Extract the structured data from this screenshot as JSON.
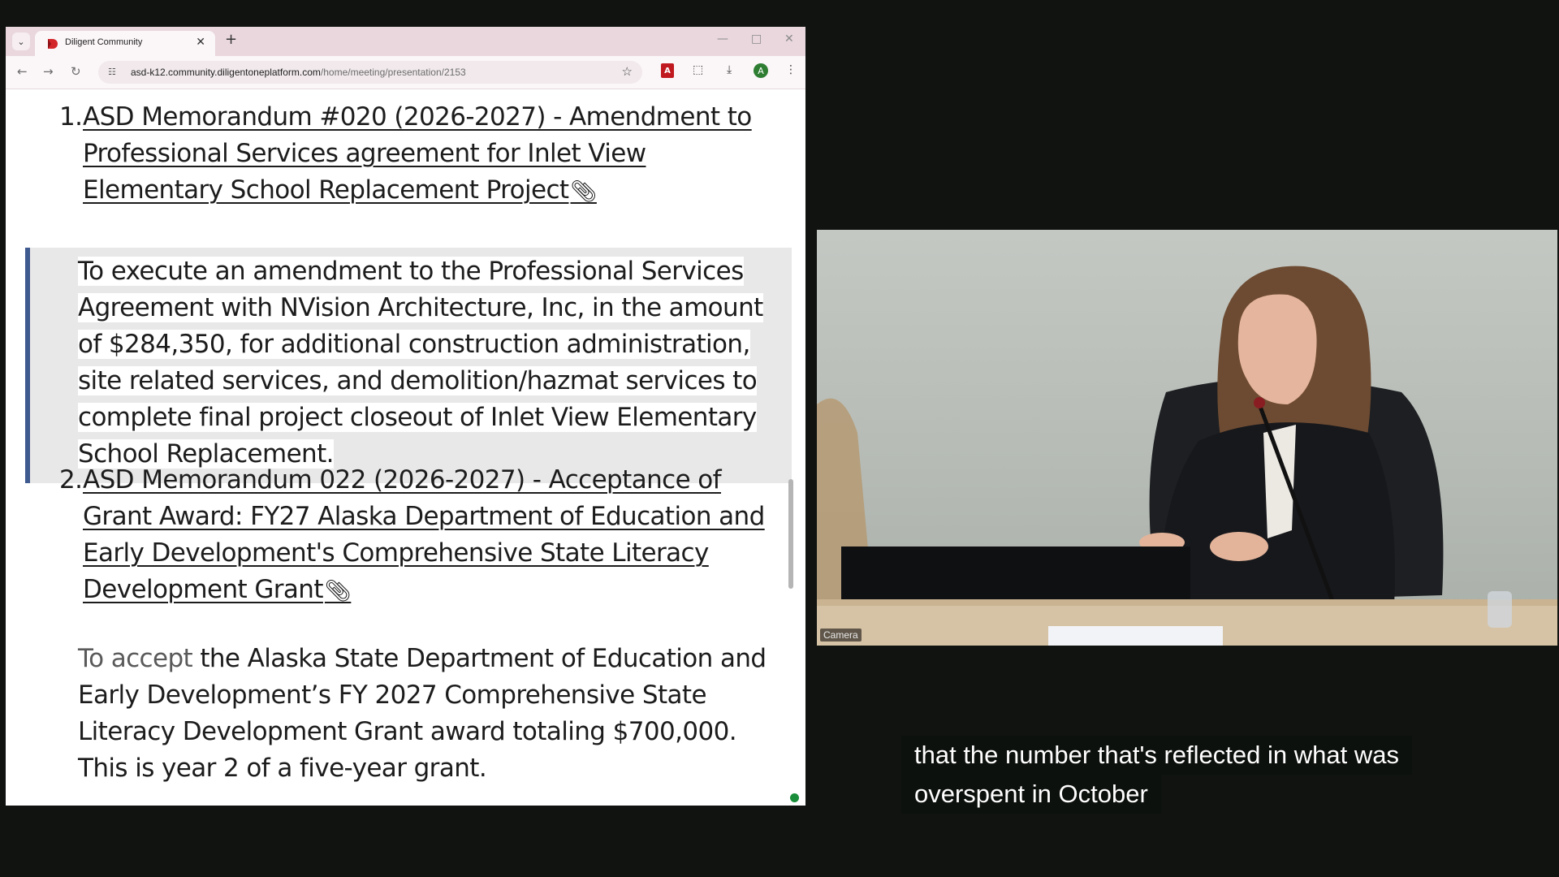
{
  "browser": {
    "tab_title": "Diligent Community",
    "url_host": "asd-k12.community.diligentoneplatform.com",
    "url_path": "/home/meeting/presentation/2153",
    "avatar_letter": "A",
    "pdf_label": "A"
  },
  "document": {
    "items": [
      {
        "number": "1.",
        "title": "ASD Memorandum #020 (2026-2027) - Amendment to Professional Services agreement for Inlet View Elementary School Replacement Project",
        "description": "To execute an amendment to the Professional Services Agreement with NVision Architecture, Inc, in the amount of $284,350, for additional construction administration, site related services, and demolition/hazmat services to complete final project closeout of Inlet View Elementary School Replacement."
      },
      {
        "number": "2.",
        "title": "ASD Memorandum 022 (2026-2027) - Acceptance of Grant Award: FY27 Alaska Department of Education and Early Development's Comprehensive State Literacy Development Grant",
        "description_lead": "To accept",
        "description_rest": " the Alaska State Department of Education and Early Development’s FY 2027 Comprehensive State Literacy Development Grant award totaling  $700,000. This is year 2 of a five-year grant."
      }
    ]
  },
  "camera": {
    "label": "Camera"
  },
  "caption": {
    "line1": "that the number that's reflected in what was",
    "line2": "overspent in October"
  },
  "colors": {
    "quote_bar": "#3f5a8f",
    "quote_bg": "#e8e8e8",
    "tab_strip": "#e9d7dd",
    "status_green": "#1a8d3a"
  }
}
